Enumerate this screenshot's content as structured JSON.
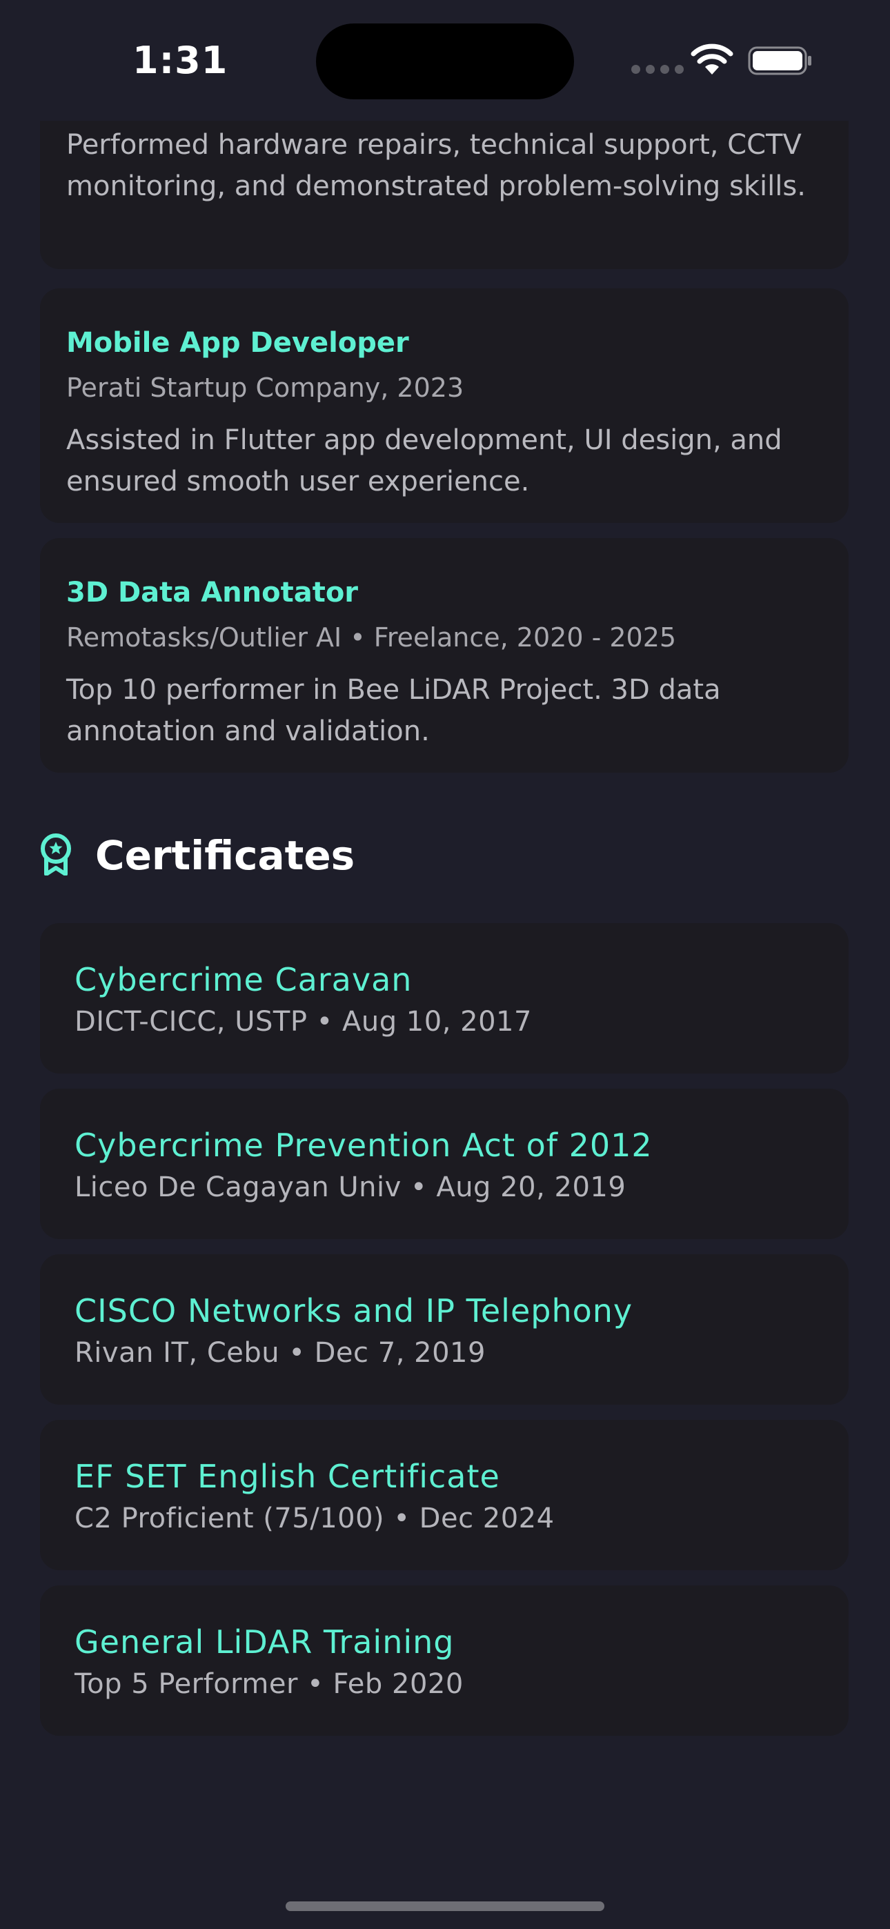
{
  "status_bar": {
    "time": "1:31"
  },
  "experience": [
    {
      "title": "",
      "subtitle": "",
      "description": "Performed hardware repairs, technical support, CCTV monitoring, and demonstrated problem-solving skills."
    },
    {
      "title": "Mobile App Developer",
      "subtitle": "Perati Startup Company, 2023",
      "description": "Assisted in Flutter app development, UI design, and ensured smooth user experience."
    },
    {
      "title": "3D Data Annotator",
      "subtitle": "Remotasks/Outlier AI • Freelance, 2020 - 2025",
      "description": "Top 10 performer in Bee LiDAR Project. 3D data annotation and validation."
    }
  ],
  "certificates_section": {
    "title": "Certificates",
    "icon": "award-badge-icon",
    "items": [
      {
        "title": "Cybercrime Caravan",
        "subtitle": "DICT-CICC, USTP • Aug 10, 2017"
      },
      {
        "title": "Cybercrime Prevention Act of 2012",
        "subtitle": "Liceo De Cagayan Univ • Aug 20, 2019"
      },
      {
        "title": "CISCO Networks and IP Telephony",
        "subtitle": "Rivan IT, Cebu • Dec 7, 2019"
      },
      {
        "title": "EF SET English Certificate",
        "subtitle": "C2 Proficient (75/100) • Dec 2024"
      },
      {
        "title": "General LiDAR Training",
        "subtitle": "Top 5 Performer • Feb 2020"
      }
    ]
  },
  "colors": {
    "background": "#1e1e2a",
    "card": "#1c1b21",
    "accent": "#5ef0d2",
    "text_secondary": "#b5b5bb"
  }
}
